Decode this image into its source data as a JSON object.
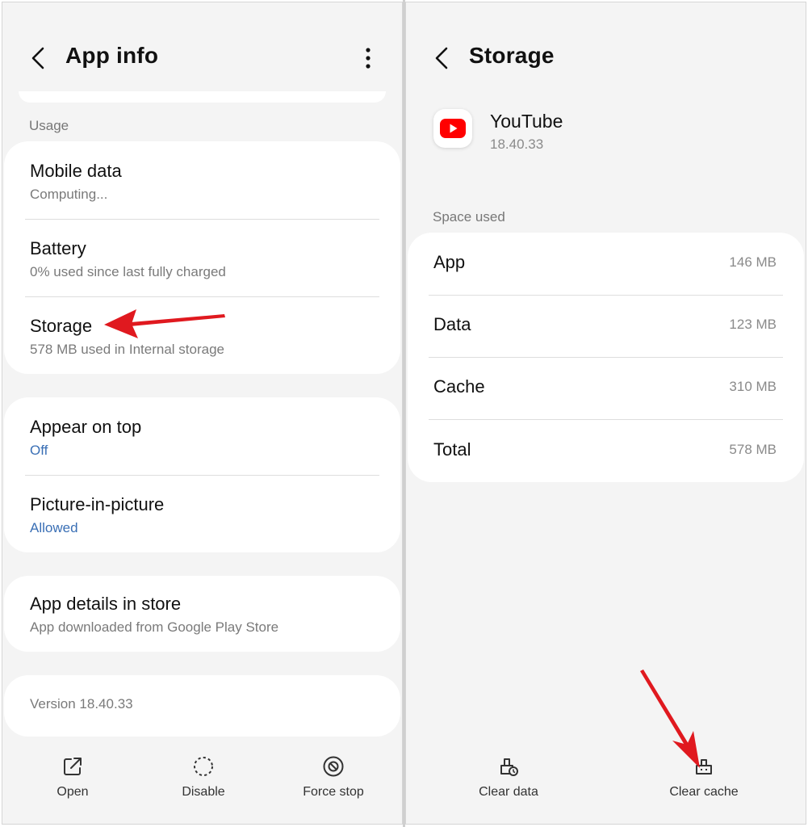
{
  "left": {
    "header": {
      "title": "App info"
    },
    "usage_section_label": "Usage",
    "usage_items": [
      {
        "title": "Mobile data",
        "subtitle": "Computing..."
      },
      {
        "title": "Battery",
        "subtitle": "0% used since last fully charged"
      },
      {
        "title": "Storage",
        "subtitle": "578 MB used in Internal storage"
      }
    ],
    "permission_items": [
      {
        "title": "Appear on top",
        "subtitle": "Off"
      },
      {
        "title": "Picture-in-picture",
        "subtitle": "Allowed"
      }
    ],
    "store_item": {
      "title": "App details in store",
      "subtitle": "App downloaded from Google Play Store"
    },
    "version_text": "Version 18.40.33",
    "bottom_actions": [
      {
        "label": "Open",
        "icon": "open-external-icon"
      },
      {
        "label": "Disable",
        "icon": "disable-icon"
      },
      {
        "label": "Force stop",
        "icon": "force-stop-icon"
      }
    ]
  },
  "right": {
    "header": {
      "title": "Storage"
    },
    "app": {
      "name": "YouTube",
      "version": "18.40.33",
      "icon": "youtube-icon",
      "brand_color": "#ff0000"
    },
    "space_used_label": "Space used",
    "rows": [
      {
        "label": "App",
        "value": "146 MB"
      },
      {
        "label": "Data",
        "value": "123 MB"
      },
      {
        "label": "Cache",
        "value": "310 MB"
      },
      {
        "label": "Total",
        "value": "578 MB"
      }
    ],
    "bottom_actions": [
      {
        "label": "Clear data",
        "icon": "clear-data-icon"
      },
      {
        "label": "Clear cache",
        "icon": "clear-cache-icon"
      }
    ]
  },
  "colors": {
    "background": "#f4f4f4",
    "card": "#ffffff",
    "link": "#3a6fb5",
    "annotation_arrow": "#e0191f"
  }
}
